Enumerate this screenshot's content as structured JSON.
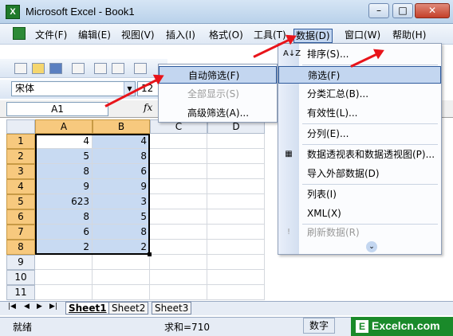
{
  "window": {
    "title": "Microsoft Excel - Book1",
    "minimize": "–",
    "restore": "□",
    "close": "✕"
  },
  "menubar": {
    "items": [
      "文件(F)",
      "编辑(E)",
      "视图(V)",
      "插入(I)",
      "格式(O)",
      "工具(T)",
      "数据(D)",
      "窗口(W)",
      "帮助(H)"
    ],
    "active": "数据(D)"
  },
  "format_toolbar": {
    "font": "宋体",
    "size": "12"
  },
  "formula_bar": {
    "name_box": "A1",
    "fx": "fx"
  },
  "sheet": {
    "columns": [
      "A",
      "B",
      "C",
      "D"
    ],
    "rows": [
      "1",
      "2",
      "3",
      "4",
      "5",
      "6",
      "7",
      "8",
      "9",
      "10",
      "11"
    ],
    "data": [
      [
        "4",
        "4"
      ],
      [
        "5",
        "8"
      ],
      [
        "8",
        "6"
      ],
      [
        "9",
        "9"
      ],
      [
        "623",
        "3"
      ],
      [
        "8",
        "5"
      ],
      [
        "6",
        "8"
      ],
      [
        "2",
        "2"
      ]
    ]
  },
  "data_menu": {
    "items": [
      {
        "label": "排序(S)...",
        "icon": "sort-icon",
        "glyph": "A↓Z"
      },
      {
        "label": "筛选(F)",
        "icon": "",
        "glyph": "",
        "highlight": true
      },
      {
        "label": "分类汇总(B)...",
        "icon": "",
        "glyph": ""
      },
      {
        "label": "有效性(L)...",
        "icon": "",
        "glyph": ""
      },
      {
        "label": "分列(E)...",
        "icon": "",
        "glyph": ""
      },
      {
        "label": "数据透视表和数据透视图(P)...",
        "icon": "pivot-icon",
        "glyph": "▦"
      },
      {
        "label": "导入外部数据(D)",
        "icon": "",
        "glyph": ""
      },
      {
        "label": "列表(I)",
        "icon": "",
        "glyph": ""
      },
      {
        "label": "XML(X)",
        "icon": "",
        "glyph": ""
      },
      {
        "label": "刷新数据(R)",
        "icon": "refresh-icon",
        "glyph": "!",
        "disabled": true
      }
    ],
    "expand": "⌄"
  },
  "filter_submenu": {
    "items": [
      {
        "label": "自动筛选(F)",
        "highlight": true
      },
      {
        "label": "全部显示(S)",
        "disabled": true
      },
      {
        "label": "高级筛选(A)...",
        "disabled": false
      }
    ]
  },
  "sheet_tabs": [
    "Sheet1",
    "Sheet2",
    "Sheet3"
  ],
  "status": {
    "ready": "就绪",
    "sum": "求和=710",
    "num": "数字"
  },
  "logo": {
    "text": "Excelcn.com",
    "letter": "E"
  },
  "colors": {
    "arrow": "#e8141a",
    "selection": "#c8daf2",
    "header_selected": "#f7c97e"
  }
}
